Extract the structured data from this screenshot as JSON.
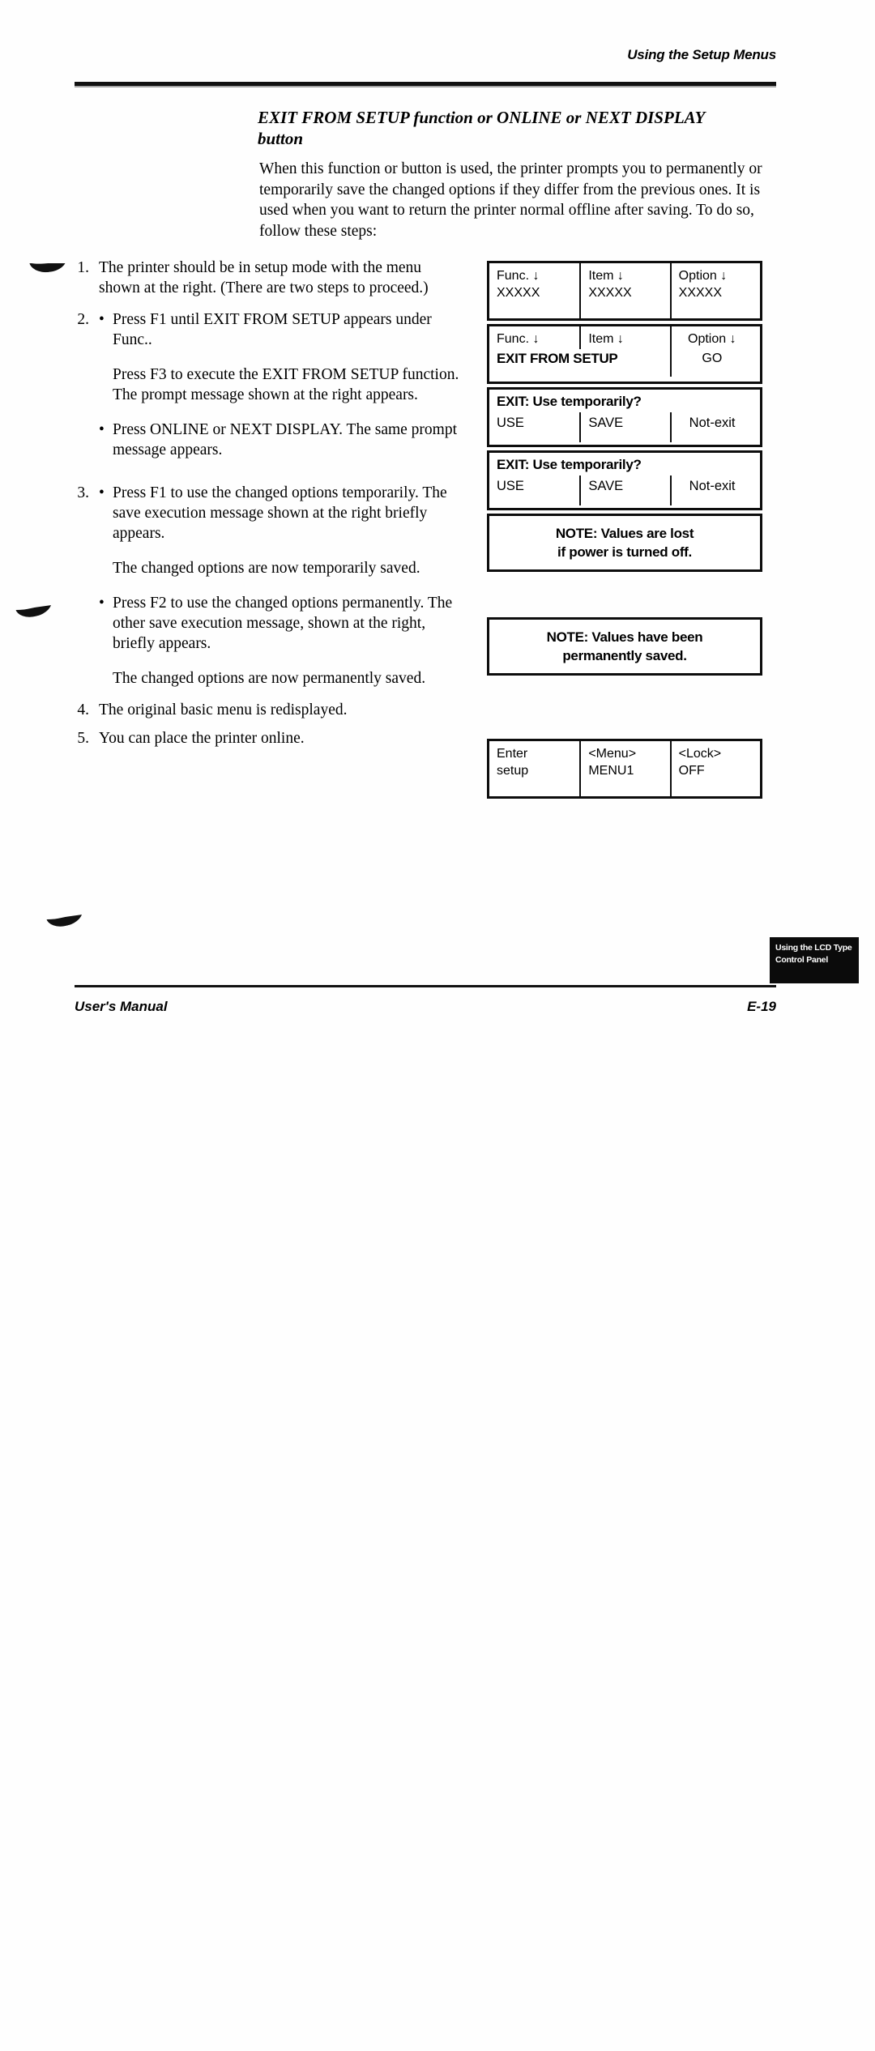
{
  "page": {
    "running_head": "Using the Setup Menus",
    "section_heading_line1": "EXIT FROM SETUP function or ONLINE or NEXT DISPLAY",
    "section_heading_line2": "button",
    "intro": "When this function or button is used, the printer prompts you to permanently or temporarily save the changed options if they differ from the previous ones. It is used when you want to return the printer normal offline after saving. To do so, follow these steps:"
  },
  "steps": [
    {
      "number": "1.",
      "paragraphs": [
        {
          "bullet": false,
          "indent": false,
          "text": "The printer should be in setup mode with the menu shown at the right. (There are two steps to proceed.)"
        }
      ]
    },
    {
      "number": "2.",
      "paragraphs": [
        {
          "bullet": true,
          "indent": false,
          "text": "Press F1 until EXIT FROM SETUP appears under Func.."
        },
        {
          "bullet": false,
          "indent": true,
          "text": "Press F3 to execute the EXIT FROM SETUP function. The prompt message shown at the right appears."
        },
        {
          "bullet": true,
          "indent": false,
          "text": "Press ONLINE or NEXT DISPLAY. The same prompt message appears."
        }
      ]
    },
    {
      "number": "3.",
      "paragraphs": [
        {
          "bullet": true,
          "indent": false,
          "text": "Press F1 to use the changed options temporarily. The save execution message shown at the right briefly appears."
        },
        {
          "bullet": false,
          "indent": true,
          "text": "The changed options are now temporarily saved."
        },
        {
          "bullet": true,
          "indent": false,
          "text": "Press F2 to use the changed options permanently. The other save execution message, shown at the right, briefly appears."
        },
        {
          "bullet": false,
          "indent": true,
          "text": "The changed options are now permanently saved."
        }
      ]
    },
    {
      "number": "4.",
      "paragraphs": [
        {
          "bullet": false,
          "indent": false,
          "text": "The original basic menu is redisplayed."
        }
      ]
    },
    {
      "number": "5.",
      "paragraphs": [
        {
          "bullet": false,
          "indent": false,
          "text": "You can place the printer online."
        }
      ]
    }
  ],
  "panels": {
    "basic_menu": {
      "cells": [
        {
          "line1": "Func. ↓",
          "line2": "XXXXX"
        },
        {
          "line1": "Item ↓",
          "line2": "XXXXX"
        },
        {
          "line1": "Option ↓",
          "line2": "XXXXX"
        }
      ]
    },
    "exit_function": {
      "head": [
        "Func. ↓",
        "Item ↓",
        "Option ↓"
      ],
      "span_label": "EXIT FROM SETUP",
      "option_value": "GO"
    },
    "prompt_a": {
      "prompt": "EXIT: Use temporarily?",
      "choices": [
        "USE",
        "SAVE",
        "Not-exit"
      ]
    },
    "prompt_b": {
      "prompt": "EXIT: Use temporarily?",
      "choices": [
        "USE",
        "SAVE",
        "Not-exit"
      ]
    },
    "note_temporary": {
      "line1": "NOTE: Values are lost",
      "line2": "if power is turned off."
    },
    "note_permanent": {
      "line1": "NOTE: Values have been",
      "line2": "permanently saved."
    },
    "basic_menu_final": {
      "cells": [
        {
          "line1": "Enter",
          "line2": "setup"
        },
        {
          "line1": "<Menu>",
          "line2": "MENU1"
        },
        {
          "line1": "<Lock>",
          "line2": "OFF"
        }
      ]
    }
  },
  "footer": {
    "left": "User's Manual",
    "page_number": "E-19",
    "thumb_tab_line1": "Using the LCD Type",
    "thumb_tab_line2": "Control Panel"
  }
}
